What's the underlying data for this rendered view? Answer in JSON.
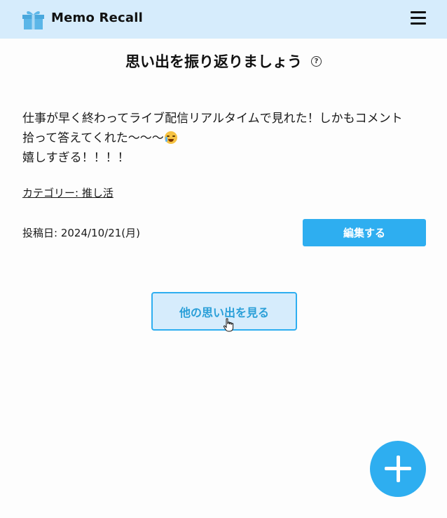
{
  "header": {
    "app_title": "Memo Recall",
    "logo_icon": "gift-icon",
    "menu_icon": "hamburger-menu-icon"
  },
  "page": {
    "title": "思い出を振り返りましょう",
    "help_icon_glyph": "?"
  },
  "memo": {
    "lines": [
      "仕事が早く終わってライブ配信リアルタイムで見れた！しかもコメント",
      "拾って答えてくれた〜〜〜",
      "嬉しすぎる！！！！"
    ],
    "emoji": "crying-face-emoji",
    "category_label": "カテゴリー: 推し活",
    "post_date": "投稿日: 2024/10/21(月)"
  },
  "buttons": {
    "edit_label": "編集する",
    "other_memories_label": "他の思い出を見る",
    "add_icon": "plus-icon"
  },
  "colors": {
    "header_bg": "#d6ecfc",
    "accent": "#2eaef0",
    "accent_text": "#2a9fd8",
    "gift_icon": "#5bb6e8"
  }
}
